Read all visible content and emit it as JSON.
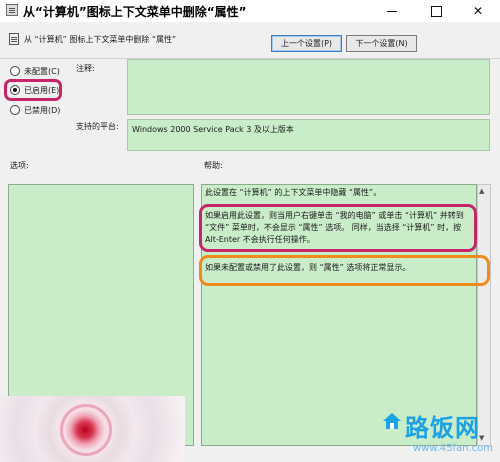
{
  "window": {
    "title": "从“计算机”图标上下文菜单中删除“属性”",
    "min_label": "—",
    "close_label": "✕"
  },
  "header": {
    "title": "从 “计算机” 图标上下文菜单中删除 “属性”",
    "prev_button": "上一个设置(P)",
    "next_button": "下一个设置(N)"
  },
  "radios": {
    "unconfigured": "未配置(C)",
    "enabled": "已启用(E)",
    "disabled": "已禁用(D)",
    "selected": "enabled"
  },
  "comment": {
    "label": "注释:",
    "value": ""
  },
  "platform": {
    "label": "支持的平台:",
    "value": "Windows 2000 Service Pack 3 及以上版本"
  },
  "options": {
    "label": "选项:"
  },
  "help": {
    "label": "帮助:",
    "line1": "此设置在 “计算机” 的上下文菜单中隐藏 “属性”。",
    "para2": "如果启用此设置，则当用户右键单击 “我的电脑” 或单击 “计算机” 并转到 “文件” 菜单时，不会显示 “属性” 选项。 同样，当选择 “计算机” 时，按 Alt-Enter 不会执行任何操作。",
    "para3": "如果未配置或禁用了此设置，则 “属性” 选项将正常显示。"
  },
  "watermark": {
    "logo_text": "路饭网",
    "url": "www.45fan.com"
  },
  "colors": {
    "panel_green": "#c9ecc9",
    "highlight_pink": "#c8246a",
    "highlight_orange": "#ef8a1c",
    "watermark_blue": "#1aa1e6"
  }
}
